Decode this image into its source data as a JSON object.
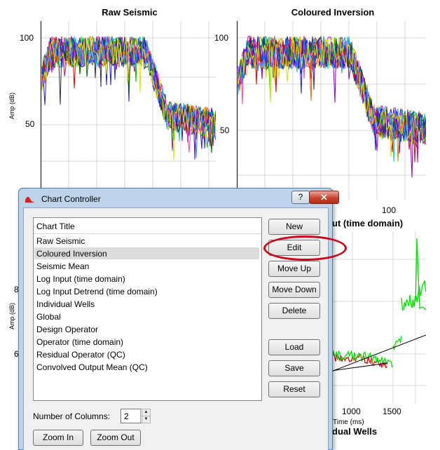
{
  "charts": {
    "raw_seismic": {
      "title": "Raw Seismic",
      "ylabel": "Amp (dB)",
      "yticks": [
        "100",
        "50"
      ]
    },
    "coloured_inversion": {
      "title": "Coloured Inversion",
      "yticks": [
        "100",
        "50"
      ],
      "xtick": "100",
      "xlabel_fragment": "ut (time domain)"
    },
    "individual_wells": {
      "ylabel": "Amp (dB)",
      "yticks_fragment": [
        "8",
        "6"
      ],
      "xticks": [
        "1000",
        "1500"
      ],
      "xlabel": "Time (ms)",
      "title_fragment": "dual Wells"
    }
  },
  "dialog": {
    "title": "Chart Controller",
    "help_label": "?",
    "close_label": "✕",
    "list_header": "Chart Title",
    "items": [
      "Raw Seismic",
      "Coloured Inversion",
      "Seismic Mean",
      "Log Input (time domain)",
      "Log Input Detrend (time domain)",
      "Individual Wells",
      "Global",
      "Design Operator",
      "Operator (time domain)",
      "Residual Operator (QC)",
      "Convolved Output Mean (QC)"
    ],
    "selected_index": 1,
    "buttons": {
      "new": "New",
      "edit": "Edit",
      "move_up": "Move Up",
      "move_down": "Move Down",
      "delete": "Delete",
      "load": "Load",
      "save": "Save",
      "reset": "Reset",
      "zoom_in": "Zoom In",
      "zoom_out": "Zoom Out"
    },
    "columns_label": "Number of Columns:",
    "columns_value": "2",
    "highlight_color": "#d0021b"
  }
}
